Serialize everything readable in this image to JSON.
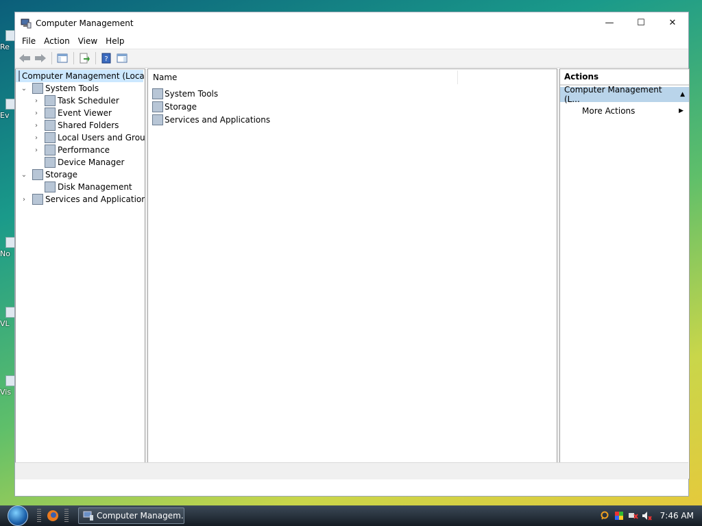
{
  "window": {
    "title": "Computer Management",
    "buttons": {
      "minimize": "—",
      "maximize": "☐",
      "close": "✕"
    }
  },
  "menu": [
    "File",
    "Action",
    "View",
    "Help"
  ],
  "tree": [
    {
      "label": "Computer Management (Local",
      "depth": 0,
      "expander": "",
      "icon": "computer-management-icon",
      "selected": true
    },
    {
      "label": "System Tools",
      "depth": 1,
      "expander": "down",
      "icon": "system-tools-icon"
    },
    {
      "label": "Task Scheduler",
      "depth": 2,
      "expander": "right",
      "icon": "task-scheduler-icon"
    },
    {
      "label": "Event Viewer",
      "depth": 2,
      "expander": "right",
      "icon": "event-viewer-icon"
    },
    {
      "label": "Shared Folders",
      "depth": 2,
      "expander": "right",
      "icon": "shared-folders-icon"
    },
    {
      "label": "Local Users and Groups",
      "depth": 2,
      "expander": "right",
      "icon": "local-users-icon"
    },
    {
      "label": "Performance",
      "depth": 2,
      "expander": "right",
      "icon": "performance-icon"
    },
    {
      "label": "Device Manager",
      "depth": 2,
      "expander": "",
      "icon": "device-manager-icon"
    },
    {
      "label": "Storage",
      "depth": 1,
      "expander": "down",
      "icon": "storage-icon"
    },
    {
      "label": "Disk Management",
      "depth": 2,
      "expander": "",
      "icon": "disk-management-icon"
    },
    {
      "label": "Services and Applications",
      "depth": 1,
      "expander": "right",
      "icon": "services-applications-icon"
    }
  ],
  "list": {
    "column_header": "Name",
    "items": [
      {
        "label": "System Tools",
        "icon": "system-tools-icon"
      },
      {
        "label": "Storage",
        "icon": "storage-icon"
      },
      {
        "label": "Services and Applications",
        "icon": "services-applications-icon"
      }
    ]
  },
  "actions": {
    "header": "Actions",
    "section": "Computer Management (L...",
    "items": [
      {
        "label": "More Actions"
      }
    ]
  },
  "taskbar": {
    "task_label": "Computer Managem...",
    "clock": "7:46 AM"
  },
  "colors": {
    "selection": "#cce8ff",
    "actions_section": "#b9d4ea"
  }
}
